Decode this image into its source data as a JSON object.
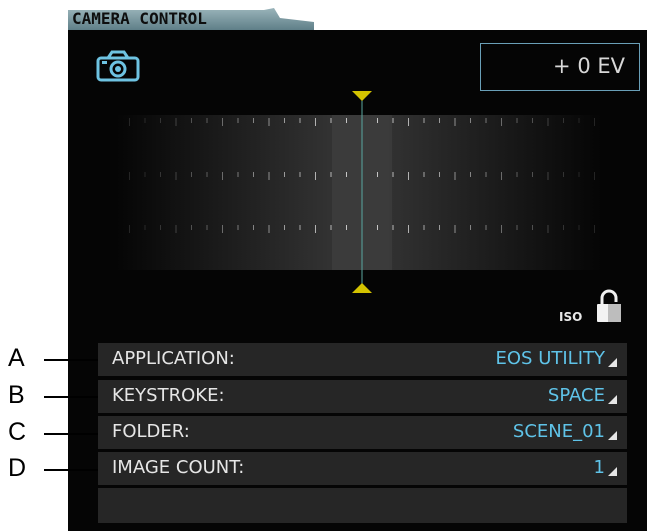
{
  "panel": {
    "title": "CAMERA CONTROL",
    "exposure_compensation": "+ 0 EV",
    "iso_label": "ISO"
  },
  "icons": {
    "camera": "camera-icon",
    "lock": "lock-icon",
    "meter_marker": "triangle-marker-icon",
    "dropdown": "dropdown-corner-icon"
  },
  "rows": [
    {
      "label": "APPLICATION:",
      "value": "EOS UTILITY",
      "callout": "A"
    },
    {
      "label": "KEYSTROKE:",
      "value": "SPACE",
      "callout": "B"
    },
    {
      "label": "FOLDER:",
      "value": "SCENE_01",
      "callout": "C"
    },
    {
      "label": "IMAGE COUNT:",
      "value": "1",
      "callout": "D"
    }
  ],
  "colors": {
    "panel_bg": "#050505",
    "row_bg": "#262626",
    "value_text": "#5fc3e8",
    "label_text": "#e6e6e6",
    "marker": "#d4c300",
    "ev_border": "#6aa0b8",
    "tab_bg": "#6d8e96"
  }
}
